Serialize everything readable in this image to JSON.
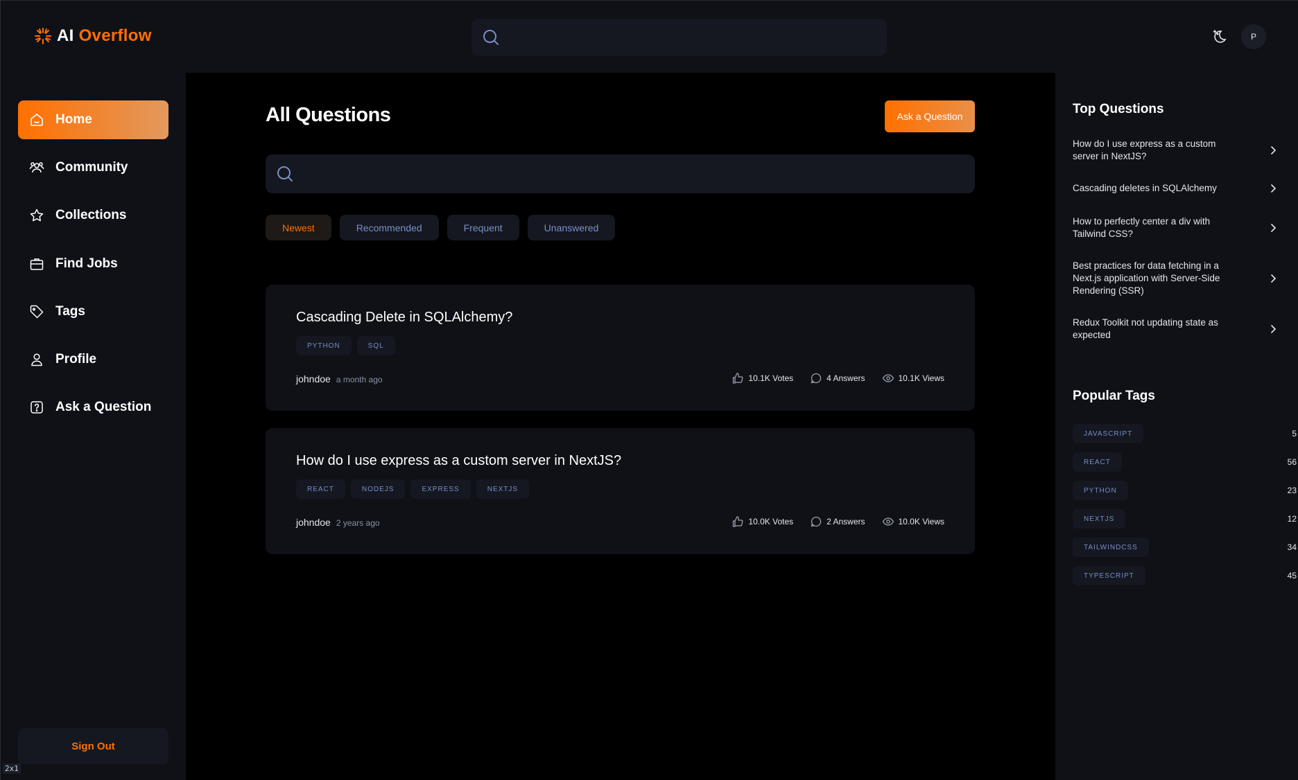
{
  "brand": {
    "name_part1": "AI",
    "name_part2": "Overflow",
    "accent": "#ff7000"
  },
  "header": {
    "search_placeholder": "",
    "avatar_initial": "P"
  },
  "sidebar": {
    "items": [
      {
        "label": "Home",
        "icon": "home-icon",
        "active": true
      },
      {
        "label": "Community",
        "icon": "users-icon"
      },
      {
        "label": "Collections",
        "icon": "star-icon"
      },
      {
        "label": "Find Jobs",
        "icon": "briefcase-icon"
      },
      {
        "label": "Tags",
        "icon": "tag-icon"
      },
      {
        "label": "Profile",
        "icon": "user-icon"
      },
      {
        "label": "Ask a Question",
        "icon": "question-icon"
      }
    ],
    "signout_label": "Sign Out",
    "scale_badge": "2x1"
  },
  "main": {
    "title": "All Questions",
    "ask_button": "Ask a Question",
    "search_placeholder": "",
    "filters": [
      "Newest",
      "Recommended",
      "Frequent",
      "Unanswered"
    ],
    "active_filter": "Newest",
    "questions": [
      {
        "title": "Cascading Delete in SQLAlchemy?",
        "tags": [
          "PYTHON",
          "SQL"
        ],
        "author": "johndoe",
        "time": "a month ago",
        "votes": "10.1K Votes",
        "answers": "4 Answers",
        "views": "10.1K Views"
      },
      {
        "title": "How do I use express as a custom server in NextJS?",
        "tags": [
          "REACT",
          "NODEJS",
          "EXPRESS",
          "NEXTJS"
        ],
        "author": "johndoe",
        "time": "2 years ago",
        "votes": "10.0K Votes",
        "answers": "2 Answers",
        "views": "10.0K Views"
      }
    ]
  },
  "right": {
    "top_questions_title": "Top Questions",
    "top_questions": [
      "How do I use express as a custom server in NextJS?",
      "Cascading deletes in SQLAlchemy",
      "How to perfectly center a div with Tailwind CSS?",
      "Best practices for data fetching in a Next.js application with Server-Side Rendering (SSR)",
      "Redux Toolkit not updating state as expected"
    ],
    "popular_tags_title": "Popular Tags",
    "popular_tags": [
      {
        "name": "JAVASCRIPT",
        "count": "5"
      },
      {
        "name": "REACT",
        "count": "56"
      },
      {
        "name": "PYTHON",
        "count": "23"
      },
      {
        "name": "NEXTJS",
        "count": "12"
      },
      {
        "name": "TAILWINDCSS",
        "count": "34"
      },
      {
        "name": "TYPESCRIPT",
        "count": "45"
      }
    ]
  }
}
